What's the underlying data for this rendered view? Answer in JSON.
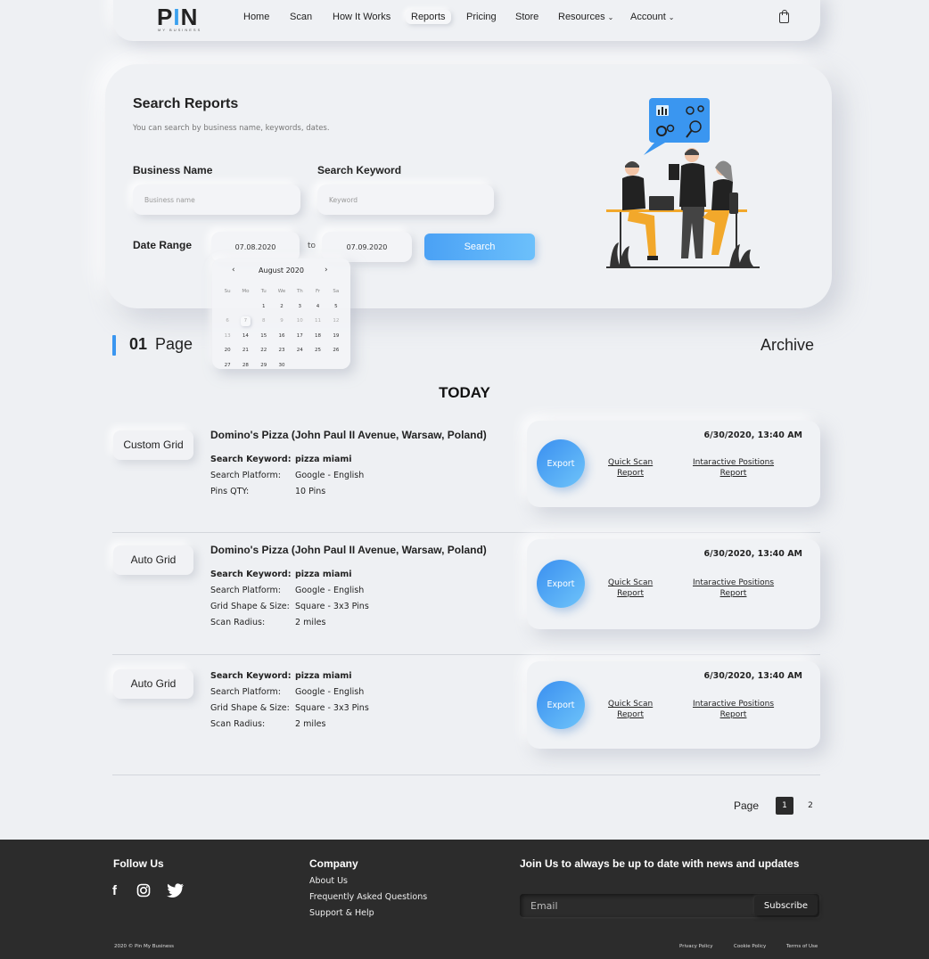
{
  "header": {
    "logo_text": "PIN",
    "logo_sub": "MY BUSINESS",
    "nav": [
      "Home",
      "Scan",
      "How It Works",
      "Reports",
      "Pricing",
      "Store",
      "Resources",
      "Account"
    ],
    "active_nav": "Reports",
    "chevron": "⌄"
  },
  "search": {
    "title": "Search Reports",
    "subtitle": "You can search by business name, keywords, dates.",
    "business_label": "Business Name",
    "business_placeholder": "Business name",
    "keyword_label": "Search Keyword",
    "keyword_placeholder": "Keyword",
    "date_label": "Date Range",
    "date_from": "07.08.2020",
    "date_to": "07.09.2020",
    "to_label": "to",
    "button": "Search"
  },
  "calendar": {
    "month": "August 2020",
    "prev": "‹",
    "next": "›",
    "weekdays": [
      "Su",
      "Mo",
      "Tu",
      "We",
      "Th",
      "Fr",
      "Sa"
    ],
    "weeks": [
      [
        "",
        "",
        "1",
        "2",
        "3",
        "4",
        "5"
      ],
      [
        "6",
        "7",
        "8",
        "9",
        "10",
        "11",
        "12"
      ],
      [
        "13",
        "14",
        "15",
        "16",
        "17",
        "18",
        "19"
      ],
      [
        "20",
        "21",
        "22",
        "23",
        "24",
        "25",
        "26"
      ],
      [
        "27",
        "28",
        "29",
        "30",
        "",
        "",
        ""
      ]
    ],
    "selected": "7"
  },
  "list": {
    "page_num": "01",
    "page_word": "Page",
    "archive": "Archive",
    "section": "TODAY"
  },
  "reports": [
    {
      "tag": "Custom Grid",
      "title": "Domino's Pizza (John Paul II Avenue, Warsaw, Poland)",
      "fields": [
        {
          "k": "Search Keyword:",
          "v": "pizza miami",
          "bold": true
        },
        {
          "k": "Search Platform:",
          "v": "Google - English",
          "bold": false
        },
        {
          "k": "Pins QTY:",
          "v": "10  Pins",
          "bold": false
        }
      ],
      "date": "6/30/2020, 13:40 AM",
      "export": "Export",
      "quick_scan": [
        "Quick Scan",
        "Report"
      ],
      "positions": [
        "Intaractive Positions",
        "Report"
      ]
    },
    {
      "tag": "Auto Grid",
      "title": "Domino's Pizza (John Paul II Avenue, Warsaw, Poland)",
      "fields": [
        {
          "k": "Search Keyword:",
          "v": "pizza miami",
          "bold": true
        },
        {
          "k": "Search Platform:",
          "v": "Google - English",
          "bold": false
        },
        {
          "k": "Grid Shape & Size:",
          "v": "Square - 3x3  Pins",
          "bold": false
        },
        {
          "k": "Scan Radius:",
          "v": "2 miles",
          "bold": false
        }
      ],
      "date": "6/30/2020, 13:40 AM",
      "export": "Export",
      "quick_scan": [
        "Quick Scan",
        "Report"
      ],
      "positions": [
        "Intaractive Positions",
        "Report"
      ]
    },
    {
      "tag": "Auto Grid",
      "title": "",
      "fields": [
        {
          "k": "Search Keyword:",
          "v": "pizza miami",
          "bold": true
        },
        {
          "k": "Search Platform:",
          "v": "Google - English",
          "bold": false
        },
        {
          "k": "Grid Shape & Size:",
          "v": "Square - 3x3  Pins",
          "bold": false
        },
        {
          "k": "Scan Radius:",
          "v": "2 miles",
          "bold": false
        }
      ],
      "date": "6/30/2020, 13:40 AM",
      "export": "Export",
      "quick_scan": [
        "Quick Scan",
        "Report"
      ],
      "positions": [
        "Intaractive Positions",
        "Report"
      ]
    }
  ],
  "pagination": {
    "label": "Page",
    "current": "1",
    "next": "2"
  },
  "footer": {
    "follow": "Follow Us",
    "social_icons": [
      "facebook-icon",
      "instagram-icon",
      "twitter-icon"
    ],
    "company": "Company",
    "links": [
      "About Us",
      "Frequently Asked Questions",
      "Support & Help"
    ],
    "newsletter": "Join Us to always be up to date with news and updates",
    "email_placeholder": "Email",
    "subscribe": "Subscribe",
    "copyright": "2020 © Pin My Business",
    "legal": [
      "Privacy Policy",
      "Cookie Policy",
      "Terms of Use"
    ]
  },
  "colors": {
    "accent": "#3a96f0",
    "background": "#eef0f3",
    "footer": "#2c2c2c",
    "orange": "#f2a82b"
  }
}
